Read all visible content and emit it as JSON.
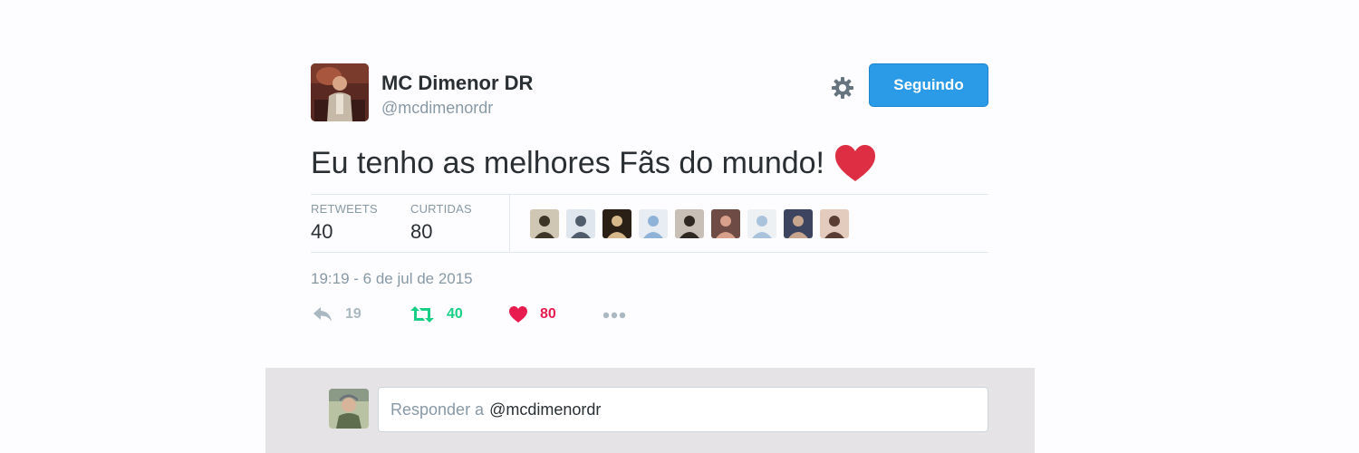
{
  "tweet": {
    "author_name": "MC Dimenor DR",
    "author_handle": "@mcdimenordr",
    "follow_button_label": "Seguindo",
    "text": "Eu tenho as melhores Fãs do mundo!",
    "emoji_icon": "red-heart-icon",
    "timestamp": "19:19 - 6 de jul de 2015"
  },
  "stats": {
    "retweets_label": "RETWEETS",
    "retweets_value": "40",
    "likes_label": "CURTIDAS",
    "likes_value": "80",
    "likers": [
      {
        "bg": "#cfc6b4",
        "fg": "#3d3527"
      },
      {
        "bg": "#dfe6ee",
        "fg": "#4f5c6b"
      },
      {
        "bg": "#2b2016",
        "fg": "#d8b98c"
      },
      {
        "bg": "#e8ecf3",
        "fg": "#8fb2d8"
      },
      {
        "bg": "#c8c0b7",
        "fg": "#2e2722"
      },
      {
        "bg": "#6e4b44",
        "fg": "#d9a08b"
      },
      {
        "bg": "#eef1f4",
        "fg": "#a9c3dc"
      },
      {
        "bg": "#3d4460",
        "fg": "#c7a58e"
      },
      {
        "bg": "#e3cbbd",
        "fg": "#5a3d33"
      }
    ]
  },
  "actions": {
    "reply_count": "19",
    "retweet_count": "40",
    "like_count": "80"
  },
  "reply_box": {
    "placeholder": "Responder a",
    "mention": "@mcdimenordr"
  },
  "colors": {
    "follow_blue": "#2b9be8",
    "retweet_green": "#19cf86",
    "like_red": "#e81c4f",
    "muted_gray": "#8899a6"
  }
}
